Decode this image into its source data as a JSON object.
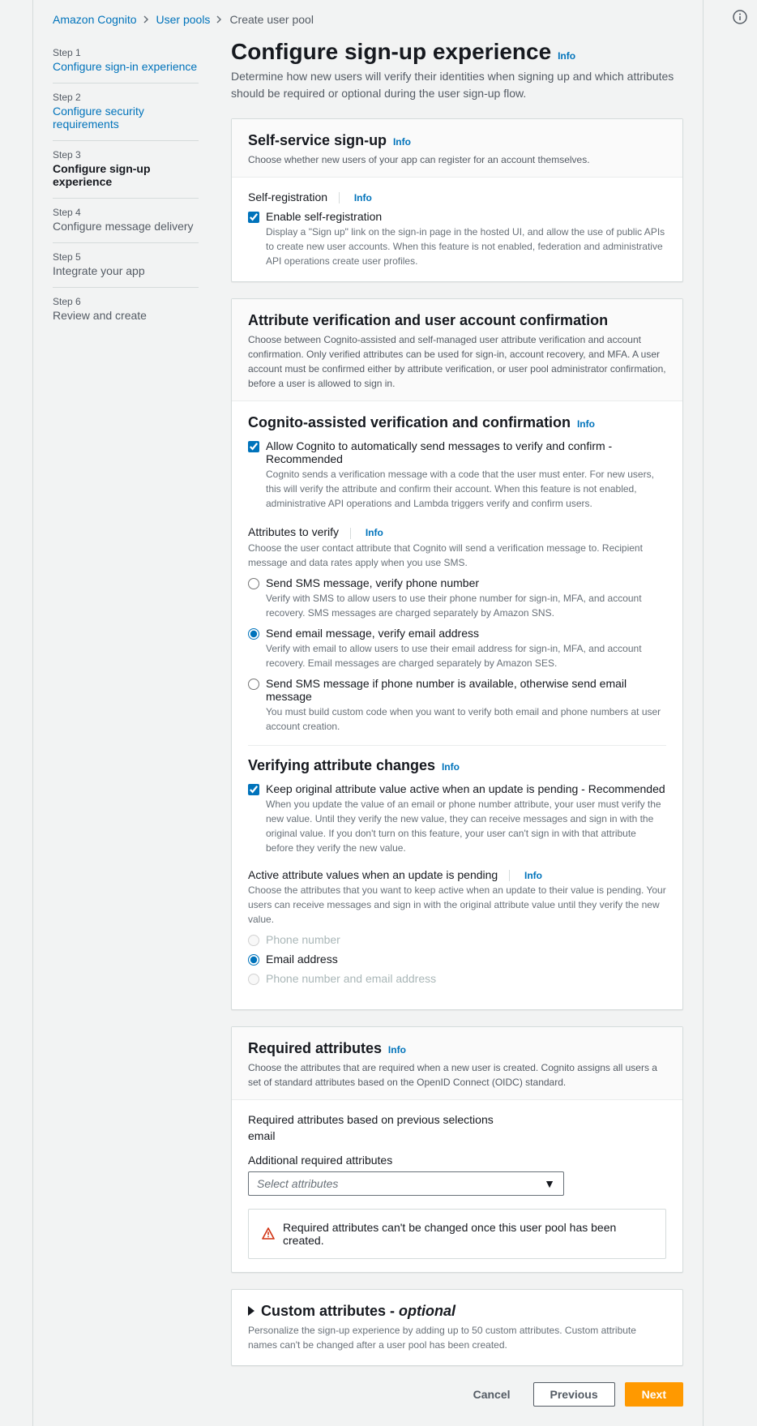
{
  "breadcrumb": {
    "items": [
      "Amazon Cognito",
      "User pools",
      "Create user pool"
    ]
  },
  "steps": [
    {
      "label": "Step 1",
      "title": "Configure sign-in experience",
      "link": true
    },
    {
      "label": "Step 2",
      "title": "Configure security requirements",
      "link": true
    },
    {
      "label": "Step 3",
      "title": "Configure sign-up experience",
      "active": true
    },
    {
      "label": "Step 4",
      "title": "Configure message delivery"
    },
    {
      "label": "Step 5",
      "title": "Integrate your app"
    },
    {
      "label": "Step 6",
      "title": "Review and create"
    }
  ],
  "page": {
    "title": "Configure sign-up experience",
    "info": "Info",
    "desc": "Determine how new users will verify their identities when signing up and which attributes should be required or optional during the user sign-up flow."
  },
  "panel1": {
    "title": "Self-service sign-up",
    "info": "Info",
    "sub": "Choose whether new users of your app can register for an account themselves.",
    "section_title": "Self-registration",
    "section_info": "Info",
    "cb_label": "Enable self-registration",
    "cb_help": "Display a \"Sign up\" link on the sign-in page in the hosted UI, and allow the use of public APIs to create new user accounts. When this feature is not enabled, federation and administrative API operations create user profiles."
  },
  "panel2": {
    "title": "Attribute verification and user account confirmation",
    "sub": "Choose between Cognito-assisted and self-managed user attribute verification and account confirmation. Only verified attributes can be used for sign-in, account recovery, and MFA. A user account must be confirmed either by attribute verification, or user pool administrator confirmation, before a user is allowed to sign in.",
    "sec1_title": "Cognito-assisted verification and confirmation",
    "sec1_info": "Info",
    "cb1_label": "Allow Cognito to automatically send messages to verify and confirm - Recommended",
    "cb1_help": "Cognito sends a verification message with a code that the user must enter. For new users, this will verify the attribute and confirm their account. When this feature is not enabled, administrative API operations and Lambda triggers verify and confirm users.",
    "attrs_label": "Attributes to verify",
    "attrs_info": "Info",
    "attrs_help": "Choose the user contact attribute that Cognito will send a verification message to. Recipient message and data rates apply when you use SMS.",
    "r1_label": "Send SMS message, verify phone number",
    "r1_help": "Verify with SMS to allow users to use their phone number for sign-in, MFA, and account recovery. SMS messages are charged separately by Amazon SNS.",
    "r2_label": "Send email message, verify email address",
    "r2_help": "Verify with email to allow users to use their email address for sign-in, MFA, and account recovery. Email messages are charged separately by Amazon SES.",
    "r3_label": "Send SMS message if phone number is available, otherwise send email message",
    "r3_help": "You must build custom code when you want to verify both email and phone numbers at user account creation.",
    "sec2_title": "Verifying attribute changes",
    "sec2_info": "Info",
    "cb2_label": "Keep original attribute value active when an update is pending - Recommended",
    "cb2_help": "When you update the value of an email or phone number attribute, your user must verify the new value. Until they verify the new value, they can receive messages and sign in with the original value. If you don't turn on this feature, your user can't sign in with that attribute before they verify the new value.",
    "active_label": "Active attribute values when an update is pending",
    "active_info": "Info",
    "active_help": "Choose the attributes that you want to keep active when an update to their value is pending. Your users can receive messages and sign in with the original attribute value until they verify the new value.",
    "ar1": "Phone number",
    "ar2": "Email address",
    "ar3": "Phone number and email address"
  },
  "panel3": {
    "title": "Required attributes",
    "info": "Info",
    "sub": "Choose the attributes that are required when a new user is created. Cognito assigns all users a set of standard attributes based on the OpenID Connect (OIDC) standard.",
    "prev_label": "Required attributes based on previous selections",
    "prev_value": "email",
    "addl_label": "Additional required attributes",
    "select_placeholder": "Select attributes",
    "warn": "Required attributes can't be changed once this user pool has been created."
  },
  "panel4": {
    "title_a": "Custom attributes - ",
    "title_b": "optional",
    "sub": "Personalize the sign-up experience by adding up to 50 custom attributes. Custom attribute names can't be changed after a user pool has been created."
  },
  "actions": {
    "cancel": "Cancel",
    "previous": "Previous",
    "next": "Next"
  }
}
